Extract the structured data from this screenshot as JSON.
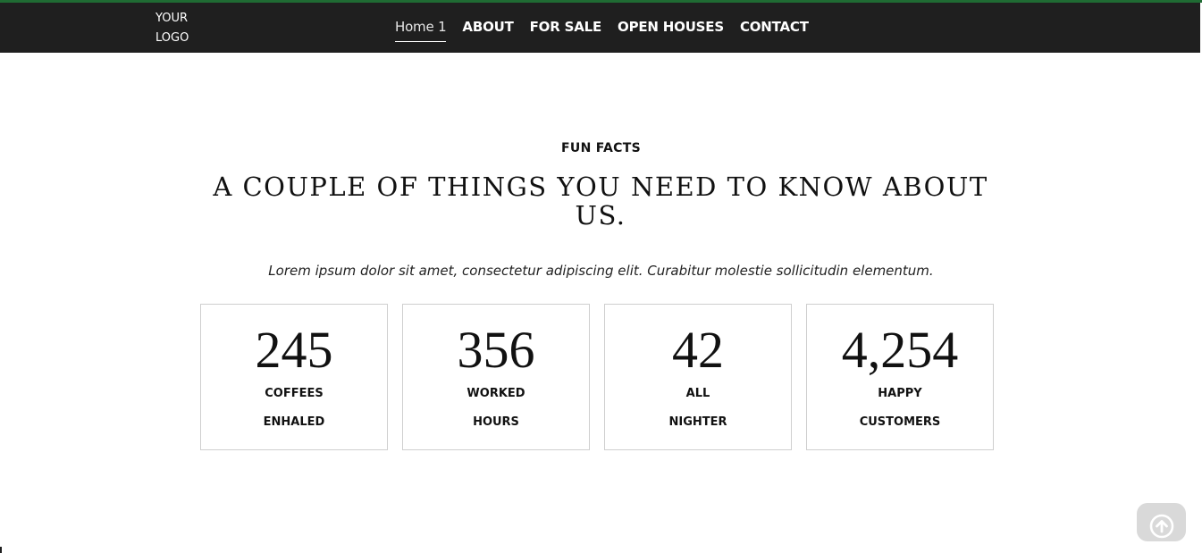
{
  "header": {
    "logo_line1": "YOUR",
    "logo_line2": "LOGO",
    "nav": [
      {
        "label": "Home 1",
        "active": true
      },
      {
        "label": "ABOUT"
      },
      {
        "label": "FOR SALE"
      },
      {
        "label": "OPEN HOUSES"
      },
      {
        "label": "CONTACT"
      }
    ]
  },
  "fun_facts": {
    "kicker": "FUN FACTS",
    "headline": "A COUPLE OF THINGS YOU NEED TO KNOW ABOUT US.",
    "lead": "Lorem ipsum dolor sit amet, consectetur adipiscing elit. Curabitur molestie sollicitudin elementum.",
    "items": [
      {
        "value": "245",
        "label_line1": "COFFEES",
        "label_line2": "ENHALED"
      },
      {
        "value": "356",
        "label_line1": "WORKED",
        "label_line2": "HOURS"
      },
      {
        "value": "42",
        "label_line1": "ALL",
        "label_line2": "NIGHTER"
      },
      {
        "value": "4,254",
        "label_line1": "HAPPY",
        "label_line2": "CUSTOMERS"
      }
    ]
  },
  "scroll_top": {
    "icon": "arrow-up-circle-icon"
  },
  "colors": {
    "navbar_bg": "#1f1f1f",
    "top_accent": "#1f6b33",
    "box_border": "#cfcfcf",
    "scroll_btn_bg": "#d9d9d9"
  }
}
